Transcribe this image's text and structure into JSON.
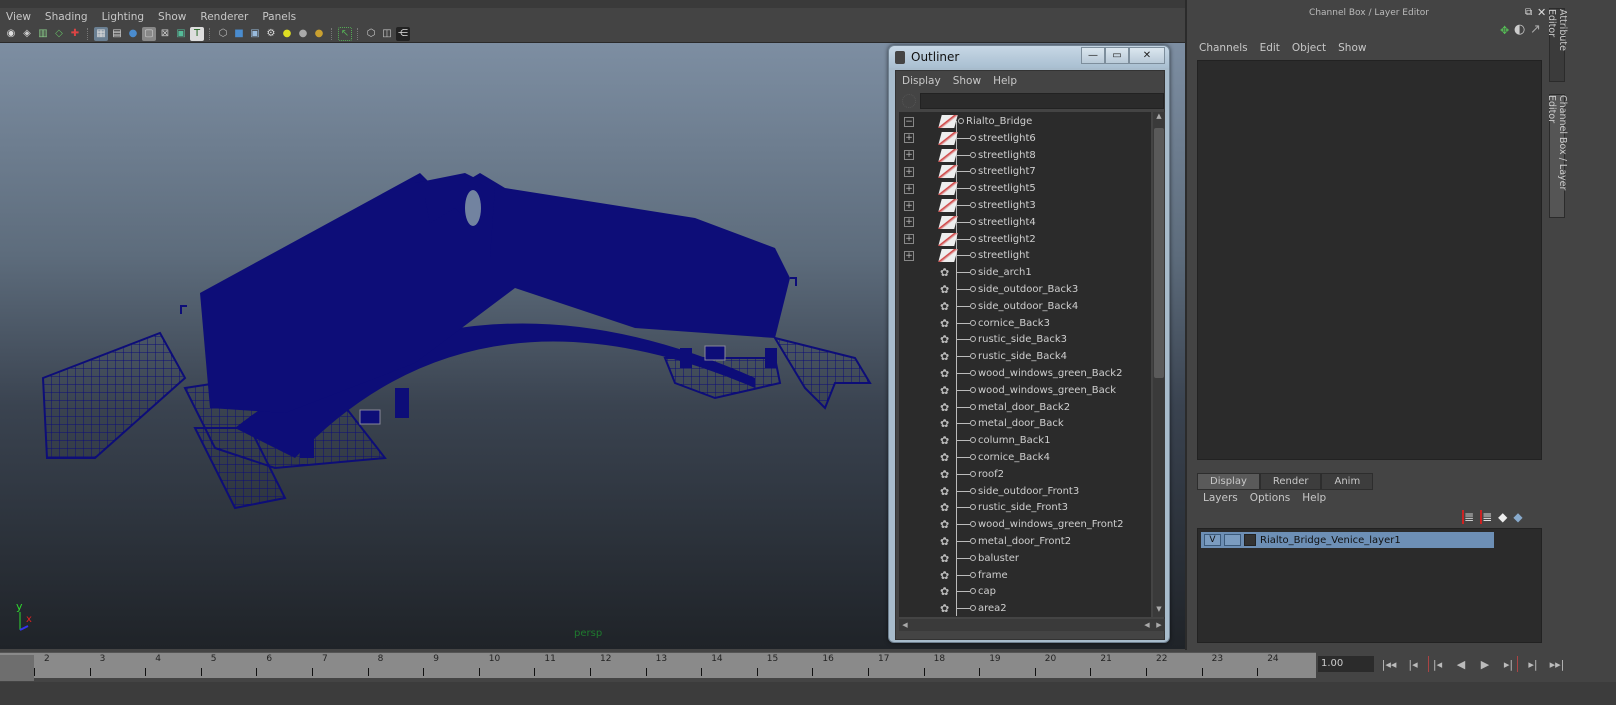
{
  "viewport": {
    "menu": [
      "View",
      "Shading",
      "Lighting",
      "Show",
      "Renderer",
      "Panels"
    ],
    "toolbar_icons": [
      "camera-icon",
      "camera-attr-icon",
      "bookmark-icon",
      "image-plane-icon",
      "2d-pan-icon",
      "grid-icon",
      "film-gate-icon",
      "resolution-gate-icon",
      "gate-mask-icon",
      "field-chart-icon",
      "safe-action-icon",
      "safe-title-icon",
      "wireframe-icon",
      "smooth-shade-icon",
      "wireframe-on-shaded-icon",
      "textured-icon",
      "default-lighting-icon",
      "all-lights-icon",
      "shadows-icon",
      "isolate-select-icon",
      "xray-icon",
      "xray-joints-icon",
      "node-editor-icon"
    ],
    "camera_label": "persp",
    "axis": {
      "y": "y",
      "x": "x"
    },
    "wire_color": "#0d0d78"
  },
  "outliner": {
    "title": "Outliner",
    "menu": [
      "Display",
      "Show",
      "Help"
    ],
    "search_value": "",
    "root": {
      "label": "Rialto_Bridge",
      "expanded": true
    },
    "items": [
      {
        "label": "streetlight6",
        "type": "group",
        "expandable": true
      },
      {
        "label": "streetlight8",
        "type": "group",
        "expandable": true
      },
      {
        "label": "streetlight7",
        "type": "group",
        "expandable": true
      },
      {
        "label": "streetlight5",
        "type": "group",
        "expandable": true
      },
      {
        "label": "streetlight3",
        "type": "group",
        "expandable": true
      },
      {
        "label": "streetlight4",
        "type": "group",
        "expandable": true
      },
      {
        "label": "streetlight2",
        "type": "group",
        "expandable": true
      },
      {
        "label": "streetlight",
        "type": "group",
        "expandable": true
      },
      {
        "label": "side_arch1",
        "type": "mesh"
      },
      {
        "label": "side_outdoor_Back3",
        "type": "mesh"
      },
      {
        "label": "side_outdoor_Back4",
        "type": "mesh"
      },
      {
        "label": "cornice_Back3",
        "type": "mesh"
      },
      {
        "label": "rustic_side_Back3",
        "type": "mesh"
      },
      {
        "label": "rustic_side_Back4",
        "type": "mesh"
      },
      {
        "label": "wood_windows_green_Back2",
        "type": "mesh"
      },
      {
        "label": "wood_windows_green_Back",
        "type": "mesh"
      },
      {
        "label": "metal_door_Back2",
        "type": "mesh"
      },
      {
        "label": "metal_door_Back",
        "type": "mesh"
      },
      {
        "label": "column_Back1",
        "type": "mesh"
      },
      {
        "label": "cornice_Back4",
        "type": "mesh"
      },
      {
        "label": "roof2",
        "type": "mesh"
      },
      {
        "label": "side_outdoor_Front3",
        "type": "mesh"
      },
      {
        "label": "rustic_side_Front3",
        "type": "mesh"
      },
      {
        "label": "wood_windows_green_Front2",
        "type": "mesh"
      },
      {
        "label": "metal_door_Front2",
        "type": "mesh"
      },
      {
        "label": "baluster",
        "type": "mesh"
      },
      {
        "label": "frame",
        "type": "mesh"
      },
      {
        "label": "cap",
        "type": "mesh"
      },
      {
        "label": "area2",
        "type": "mesh"
      }
    ]
  },
  "channel_box": {
    "title": "Channel Box / Layer Editor",
    "menu": [
      "Channels",
      "Edit",
      "Object",
      "Show"
    ]
  },
  "layer_editor": {
    "tabs": [
      "Display",
      "Render",
      "Anim"
    ],
    "active_tab": "Display",
    "menu": [
      "Layers",
      "Options",
      "Help"
    ],
    "layers": [
      {
        "visible": "V",
        "playback": "",
        "name": "Rialto_Bridge_Venice_layer1"
      }
    ],
    "layer_color": "#6d8fb5"
  },
  "side_tabs": [
    "Attribute Editor",
    "Channel Box / Layer Editor"
  ],
  "timeline": {
    "ticks": [
      "2",
      "3",
      "4",
      "5",
      "6",
      "7",
      "8",
      "9",
      "10",
      "11",
      "12",
      "13",
      "14",
      "15",
      "16",
      "17",
      "18",
      "19",
      "20",
      "21",
      "22",
      "23",
      "24"
    ],
    "current_frame": "1.00",
    "playback_buttons": [
      "go-to-start",
      "step-back-key",
      "step-back-frame",
      "play-backward",
      "play-forward",
      "step-forward-frame",
      "step-forward-key",
      "go-to-end"
    ]
  }
}
